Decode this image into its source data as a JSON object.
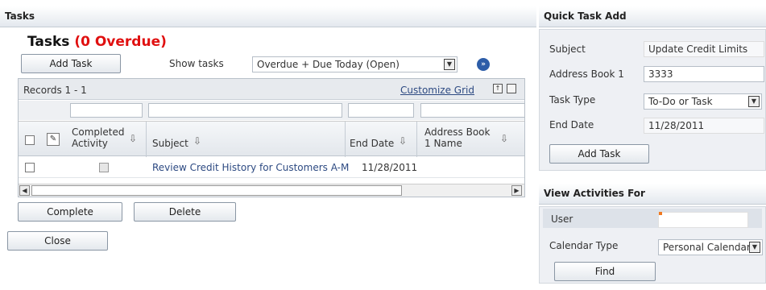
{
  "tasks_pane": {
    "title": "Tasks",
    "heading": "Tasks",
    "overdue": "(0 Overdue)",
    "add_task_label": "Add Task",
    "show_tasks_label": "Show tasks",
    "show_tasks_value": "Overdue + Due Today (Open)",
    "records_label": "Records 1 - 1",
    "customize_grid_label": "Customize Grid",
    "columns": {
      "completed": "Completed Activity",
      "subject": "Subject",
      "end_date": "End Date",
      "address_book": "Address Book 1 Name"
    },
    "rows": [
      {
        "subject": "Review Credit History for Customers A-M",
        "end_date": "11/28/2011",
        "address_book": ""
      }
    ],
    "complete_label": "Complete",
    "delete_label": "Delete",
    "close_label": "Close"
  },
  "quick_add": {
    "title": "Quick Task Add",
    "subject_label": "Subject",
    "subject_value": "Update Credit Limits",
    "address_label": "Address Book 1",
    "address_value": "3333",
    "task_type_label": "Task Type",
    "task_type_value": "To-Do or Task",
    "end_date_label": "End Date",
    "end_date_value": "11/28/2011",
    "add_task_label": "Add Task"
  },
  "view_activities": {
    "title": "View Activities For",
    "user_label": "User",
    "user_value": "",
    "calendar_type_label": "Calendar Type",
    "calendar_type_value": "Personal Calendar",
    "find_label": "Find"
  },
  "colors": {
    "overdue": "#e01010",
    "link": "#2d4a82",
    "accent_orange": "#f07820"
  }
}
